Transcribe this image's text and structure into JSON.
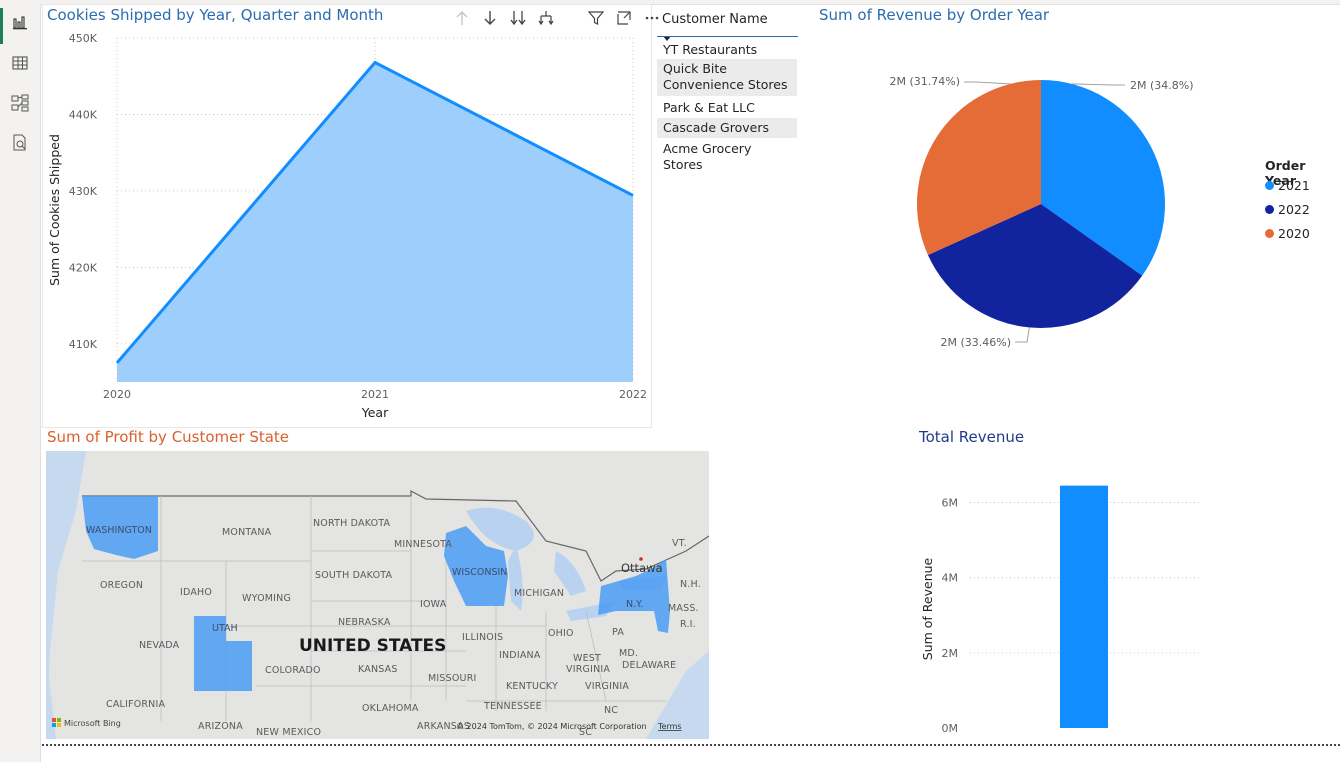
{
  "rail": {
    "icons": [
      "report-view-icon",
      "table-view-icon",
      "model-view-icon",
      "dax-query-icon"
    ]
  },
  "line_visual": {
    "title": "Cookies Shipped by Year, Quarter and Month",
    "toolbar": [
      "drill-up-icon",
      "drill-down-icon",
      "expand-next-level-icon",
      "expand-hierarchy-icon",
      "filter-icon",
      "focus-mode-icon",
      "more-options-icon"
    ]
  },
  "slicer": {
    "header": "Customer Name",
    "items": [
      "YT Restaurants",
      "Quick Bite Convenience Stores",
      "Park & Eat LLC",
      "Cascade Grovers",
      "Acme Grocery Stores"
    ]
  },
  "pie_visual": {
    "title": "Sum of Revenue by Order Year"
  },
  "map_visual": {
    "title": "Sum of Profit by Customer State",
    "labels": {
      "washington": "WASHINGTON",
      "montana": "MONTANA",
      "north_dakota": "NORTH DAKOTA",
      "minnesota": "MINNESOTA",
      "oregon": "OREGON",
      "idaho": "IDAHO",
      "wyoming": "WYOMING",
      "south_dakota": "SOUTH DAKOTA",
      "wisconsin": "WISCONSIN",
      "michigan": "MICHIGAN",
      "ottawa": "Ottawa",
      "vt": "VT.",
      "nh": "N.H.",
      "ny": "N.Y.",
      "mass": "MASS.",
      "ri": "R.I.",
      "nebraska": "NEBRASKA",
      "iowa": "IOWA",
      "nevada": "NEVADA",
      "utah": "UTAH",
      "country": "UNITED STATES",
      "illinois": "ILLINOIS",
      "ohio": "OHIO",
      "pa": "PA",
      "colorado": "COLORADO",
      "kansas": "KANSAS",
      "missouri": "MISSOURI",
      "indiana": "INDIANA",
      "west_virginia_1": "WEST",
      "west_virginia_2": "VIRGINIA",
      "md": "MD.",
      "delaware": "DELAWARE",
      "kentucky": "KENTUCKY",
      "virginia": "VIRGINIA",
      "california": "CALIFORNIA",
      "oklahoma": "OKLAHOMA",
      "tennessee": "TENNESSEE",
      "nc": "NC",
      "sc": "SC",
      "arizona": "ARIZONA",
      "new_mexico": "NEW MEXICO",
      "arkansas": "ARKANSAS"
    },
    "bing_logo": "Microsoft Bing",
    "copyright": "© 2024 TomTom, © 2024 Microsoft Corporation",
    "terms": "Terms"
  },
  "bar_visual": {
    "title": "Total Revenue"
  },
  "colors": {
    "accent_blue": "#118dff",
    "dark_blue": "#12239e",
    "orange": "#e66c37",
    "title_blue": "#2b6cb0",
    "title_orange": "#d9612e",
    "title_navy": "#1f3a8a",
    "area_fill": "#9ecffc",
    "map_highlight": "#4a9cf5"
  },
  "chart_data": [
    {
      "type": "area",
      "title": "Cookies Shipped by Year, Quarter and Month",
      "x": [
        "2020",
        "2021",
        "2022"
      ],
      "values": [
        407500,
        446800,
        429400
      ],
      "xlabel": "Year",
      "ylabel": "Sum of Cookies Shipped",
      "yticks": [
        "410K",
        "420K",
        "430K",
        "440K",
        "450K"
      ],
      "ytick_values": [
        410000,
        420000,
        430000,
        440000,
        450000
      ],
      "ylim": [
        405000,
        450000
      ],
      "grid": true
    },
    {
      "type": "pie",
      "title": "Sum of Revenue by Order Year",
      "legend_title": "Order Year",
      "legend_placement": "right",
      "slices": [
        {
          "name": "2021",
          "label": "2M (34.8%)",
          "percent": 34.8,
          "color": "#118dff"
        },
        {
          "name": "2022",
          "label": "2M (33.46%)",
          "percent": 33.46,
          "color": "#12239e"
        },
        {
          "name": "2020",
          "label": "2M (31.74%)",
          "percent": 31.74,
          "color": "#e66c37"
        }
      ]
    },
    {
      "type": "bar",
      "title": "Total Revenue",
      "categories": [
        ""
      ],
      "values": [
        6.45
      ],
      "ylabel": "Sum of Revenue",
      "yticks": [
        "0M",
        "2M",
        "4M",
        "6M"
      ],
      "ytick_values": [
        0,
        2,
        4,
        6
      ],
      "ylim": [
        0,
        6.6
      ],
      "grid": true
    }
  ]
}
